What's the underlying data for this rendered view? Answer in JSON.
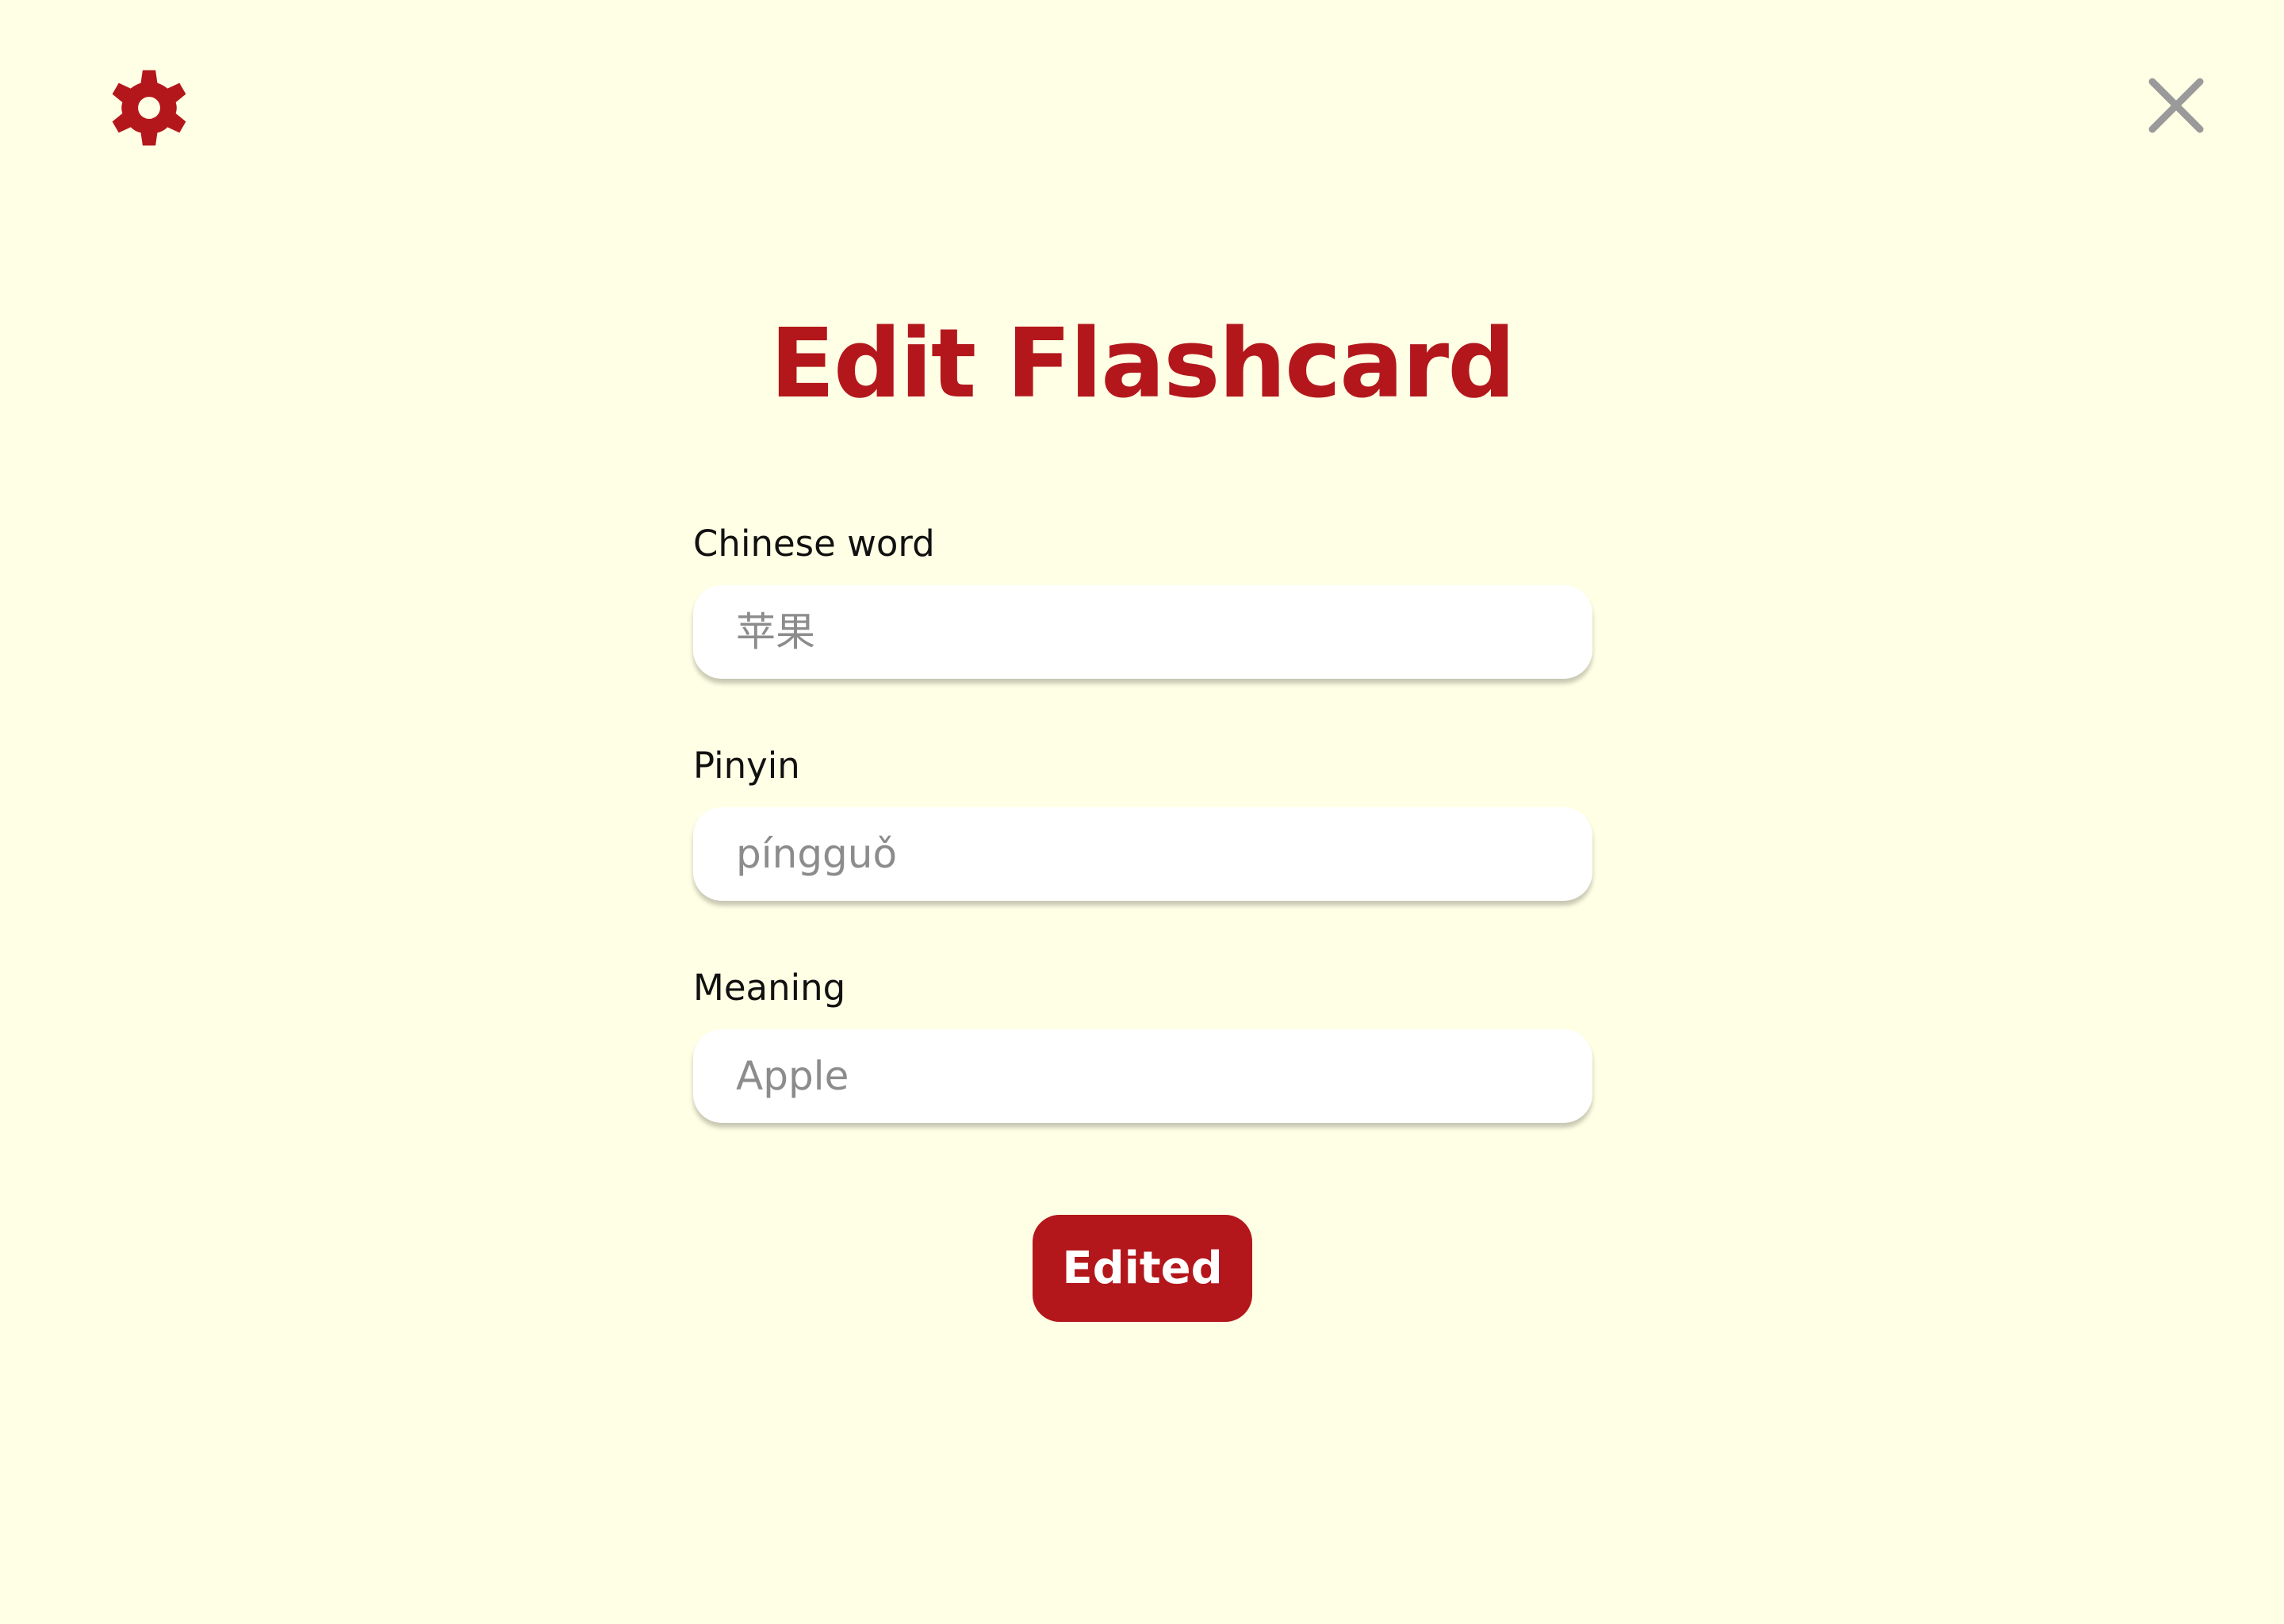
{
  "colors": {
    "background": "#ffffe5",
    "accent": "#b3171c",
    "close_icon": "#9a9a9a",
    "input_background": "#ffffff"
  },
  "header": {
    "settings_icon": "gear-icon",
    "close_icon": "close-icon"
  },
  "page": {
    "title": "Edit Flashcard"
  },
  "form": {
    "chinese_word": {
      "label": "Chinese word",
      "placeholder": "苹果",
      "value": ""
    },
    "pinyin": {
      "label": "Pinyin",
      "placeholder": "píngguǒ",
      "value": ""
    },
    "meaning": {
      "label": "Meaning",
      "placeholder": "Apple",
      "value": ""
    },
    "submit_label": "Edited"
  }
}
